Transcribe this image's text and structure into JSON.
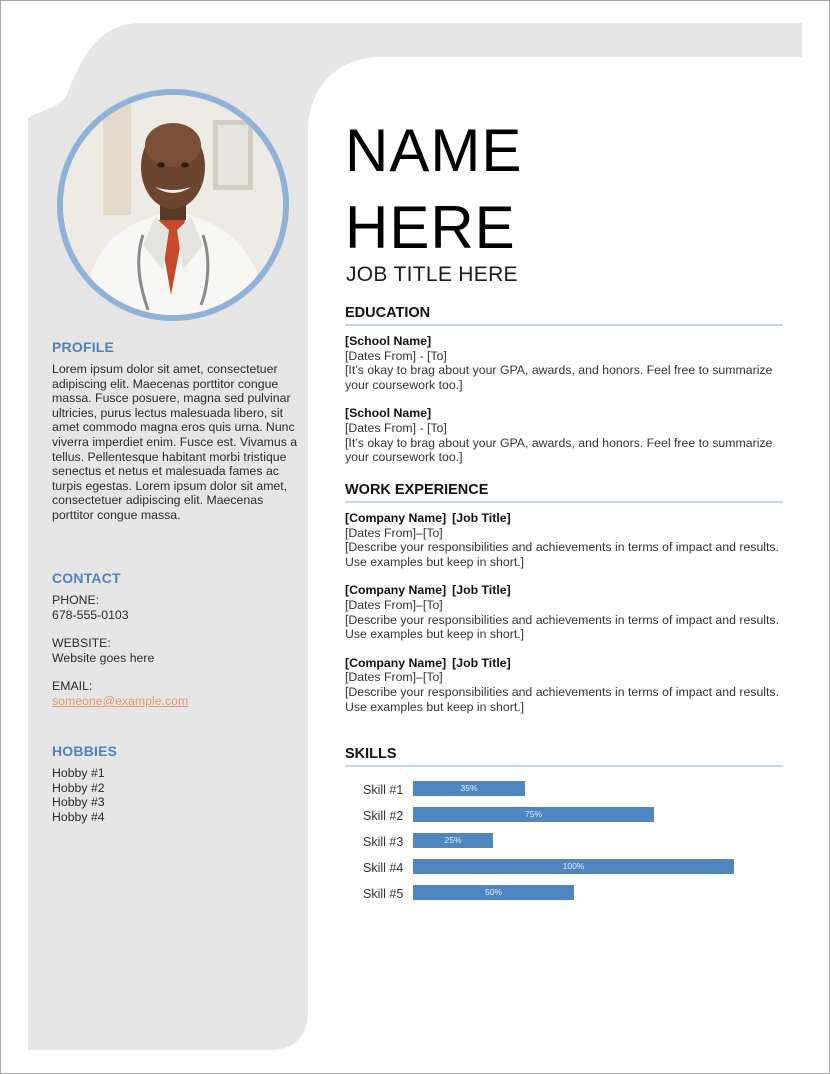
{
  "colors": {
    "panel_gray": "#e6e6e6",
    "accent_blue": "#4f81bd",
    "photo_ring": "#8fb2d8",
    "skill_bar": "#4f86c0",
    "email_link": "#e8956a",
    "rule": "#c7d6e6"
  },
  "header": {
    "name_line1": "NAME",
    "name_line2": "HERE",
    "job_title": "JOB TITLE HERE"
  },
  "sidebar": {
    "profile": {
      "heading": "PROFILE",
      "text": "Lorem ipsum dolor sit amet, consectetuer adipiscing elit. Maecenas porttitor congue massa. Fusce posuere, magna sed pulvinar ultricies, purus lectus malesuada libero, sit amet commodo magna eros quis urna. Nunc viverra imperdiet enim. Fusce est. Vivamus a tellus. Pellentesque habitant morbi tristique senectus et netus et malesuada fames ac turpis egestas. Lorem ipsum dolor sit amet, consectetuer adipiscing elit. Maecenas porttitor congue massa."
    },
    "contact": {
      "heading": "CONTACT",
      "phone_label": "PHONE:",
      "phone": "678-555-0103",
      "website_label": "WEBSITE:",
      "website": "Website goes here",
      "email_label": "EMAIL:",
      "email": "someone@example.com"
    },
    "hobbies": {
      "heading": "HOBBIES",
      "items": [
        "Hobby #1",
        "Hobby #2",
        "Hobby #3",
        "Hobby #4"
      ]
    }
  },
  "education": {
    "heading": "EDUCATION",
    "entries": [
      {
        "school": "[School Name]",
        "dates": "[Dates From] - [To]",
        "description": "[It’s okay to brag about your GPA, awards, and honors. Feel free to summarize your coursework too.]"
      },
      {
        "school": "[School Name]",
        "dates": "[Dates From] - [To]",
        "description": "[It’s okay to brag about your GPA, awards, and honors. Feel free to summarize your coursework too.]"
      }
    ]
  },
  "work": {
    "heading": "WORK EXPERIENCE",
    "entries": [
      {
        "company": "[Company Name]",
        "job_title": "[Job Title]",
        "dates": "[Dates From]–[To]",
        "description": "[Describe your responsibilities and achievements in terms of impact and results. Use examples but keep in short.]"
      },
      {
        "company": "[Company Name]",
        "job_title": "[Job Title]",
        "dates": "[Dates From]–[To]",
        "description": "[Describe your responsibilities and achievements in terms of impact and results. Use examples but keep in short.]"
      },
      {
        "company": "[Company Name]",
        "job_title": "[Job Title]",
        "dates": "[Dates From]–[To]",
        "description": "[Describe your responsibilities and achievements in terms of impact and results. Use examples but keep in short.]"
      }
    ]
  },
  "skills": {
    "heading": "SKILLS",
    "items": [
      {
        "label": "Skill #1",
        "value": 35,
        "value_label": "35%"
      },
      {
        "label": "Skill #2",
        "value": 75,
        "value_label": "75%"
      },
      {
        "label": "Skill #3",
        "value": 25,
        "value_label": "25%"
      },
      {
        "label": "Skill #4",
        "value": 100,
        "value_label": "100%"
      },
      {
        "label": "Skill #5",
        "value": 50,
        "value_label": "50%"
      }
    ]
  }
}
